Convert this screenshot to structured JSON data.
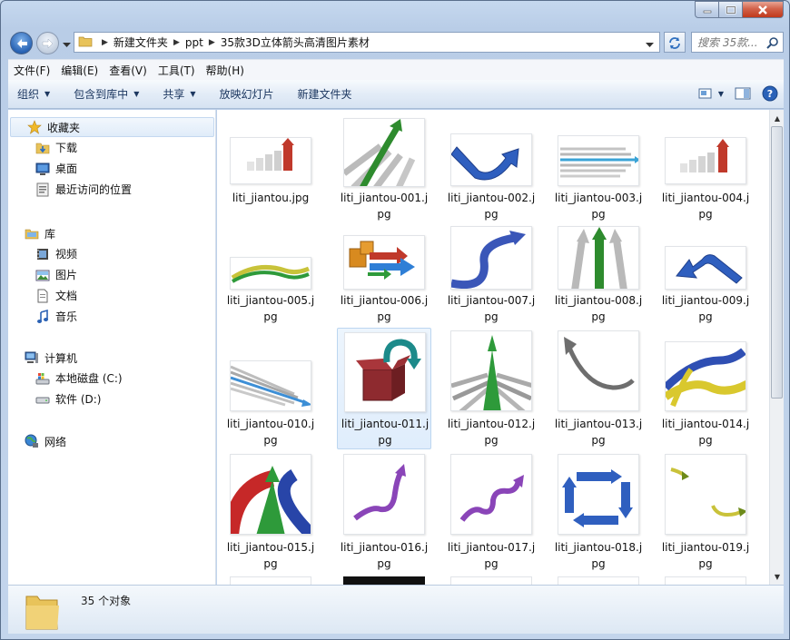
{
  "address": {
    "breadcrumbs": [
      "新建文件夹",
      "ppt",
      "35款3D立体箭头高清图片素材"
    ],
    "search_placeholder": "搜索 35款..."
  },
  "menu": [
    "文件(F)",
    "编辑(E)",
    "查看(V)",
    "工具(T)",
    "帮助(H)"
  ],
  "toolbar": {
    "organize": "组织",
    "include_in_library": "包含到库中",
    "share": "共享",
    "slideshow": "放映幻灯片",
    "new_folder": "新建文件夹"
  },
  "nav": {
    "favorites": {
      "label": "收藏夹",
      "items": [
        "下载",
        "桌面",
        "最近访问的位置"
      ]
    },
    "libraries": {
      "label": "库",
      "items": [
        "视频",
        "图片",
        "文档",
        "音乐"
      ]
    },
    "computer": {
      "label": "计算机",
      "items": [
        "本地磁盘 (C:)",
        "软件 (D:)"
      ]
    },
    "network": {
      "label": "网络"
    }
  },
  "files": [
    "liti_jiantou.jpg",
    "liti_jiantou-001.jpg",
    "liti_jiantou-002.jpg",
    "liti_jiantou-003.jpg",
    "liti_jiantou-004.jpg",
    "liti_jiantou-005.jpg",
    "liti_jiantou-006.jpg",
    "liti_jiantou-007.jpg",
    "liti_jiantou-008.jpg",
    "liti_jiantou-009.jpg",
    "liti_jiantou-010.jpg",
    "liti_jiantou-011.jpg",
    "liti_jiantou-012.jpg",
    "liti_jiantou-013.jpg",
    "liti_jiantou-014.jpg",
    "liti_jiantou-015.jpg",
    "liti_jiantou-016.jpg",
    "liti_jiantou-017.jpg",
    "liti_jiantou-018.jpg",
    "liti_jiantou-019.jpg"
  ],
  "selected_file_index": 11,
  "status": {
    "count": "35 个对象"
  },
  "colors": {
    "accent": "#1c3760",
    "selection": "#cce8ff",
    "red": "#c0392b",
    "green": "#2e9a3a",
    "blue": "#2f5fbf"
  }
}
